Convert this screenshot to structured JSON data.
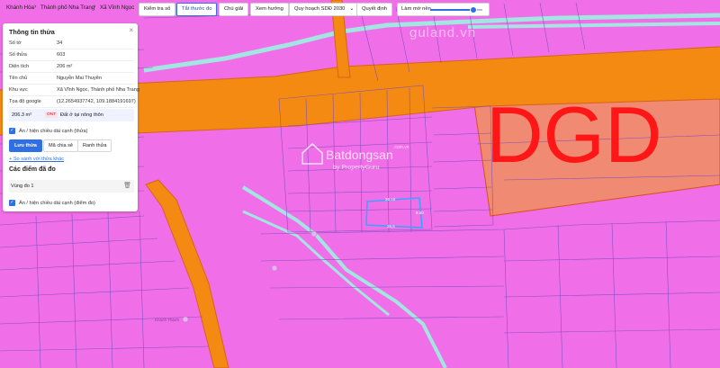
{
  "breadcrumb": [
    "Khánh Hòa",
    "Thành phố Nha Trang",
    "Xã Vĩnh Ngọc"
  ],
  "toolbar": {
    "check_plan": "Kiểm tra số",
    "ruler": "Tắt thước đo",
    "legend": "Chú giải",
    "direction": "Xem hướng",
    "plan_select": "Quy hoạch SDĐ 2030",
    "decision": "Quyết định",
    "blur_label": "Làm mờ nền",
    "blur_level": 0.82
  },
  "colors": {
    "land_pink": "#f06fe8",
    "road_orange": "#f58a12",
    "dgd_salmon": "#f08a72",
    "teal_road": "#a3e5e0",
    "selected_parcel": "#3ba3ff",
    "accent_blue": "#2f6fe6"
  },
  "watermarks": {
    "site": "guland.vn",
    "brand_main": "Batdongsan",
    "brand_domain": ".com.vn",
    "brand_sub": "by PropertyGuru"
  },
  "map": {
    "zone_code": "DGD",
    "parcel_dims": [
      "26.18",
      "9.50",
      "26.5"
    ],
    "place_label": "Khánh Thạnh"
  },
  "panel": {
    "title": "Thông tin thửa",
    "rows": [
      {
        "k": "Số tờ",
        "v": "34"
      },
      {
        "k": "Số thửa",
        "v": "603"
      },
      {
        "k": "Diện tích",
        "v": "206 m²"
      },
      {
        "k": "Tên chủ",
        "v": "Nguyễn Mai Thuyên"
      },
      {
        "k": "Khu vực",
        "v": "Xã Vĩnh Ngọc, Thành phố Nha Trang"
      },
      {
        "k": "Tọa độ google",
        "v": "(12.2654937742, 109.1884191697)"
      }
    ],
    "area_value": "206.3 m²",
    "area_tag": "ONT",
    "area_desc": "Đất ở tại nông thôn",
    "toggle_parcel": "Ẩn / hiện chiều dài cạnh (thửa)",
    "btn_save": "Lưu thửa",
    "btn_share": "Mã chia sẻ",
    "btn_border": "Ranh thửa",
    "compare_link": "+ So sánh với thửa khác",
    "measured_title": "Các điểm đã đo",
    "measure_item": "Vùng đo 1",
    "toggle_points": "Ẩn / hiện chiều dài cạnh (điểm đo)"
  }
}
